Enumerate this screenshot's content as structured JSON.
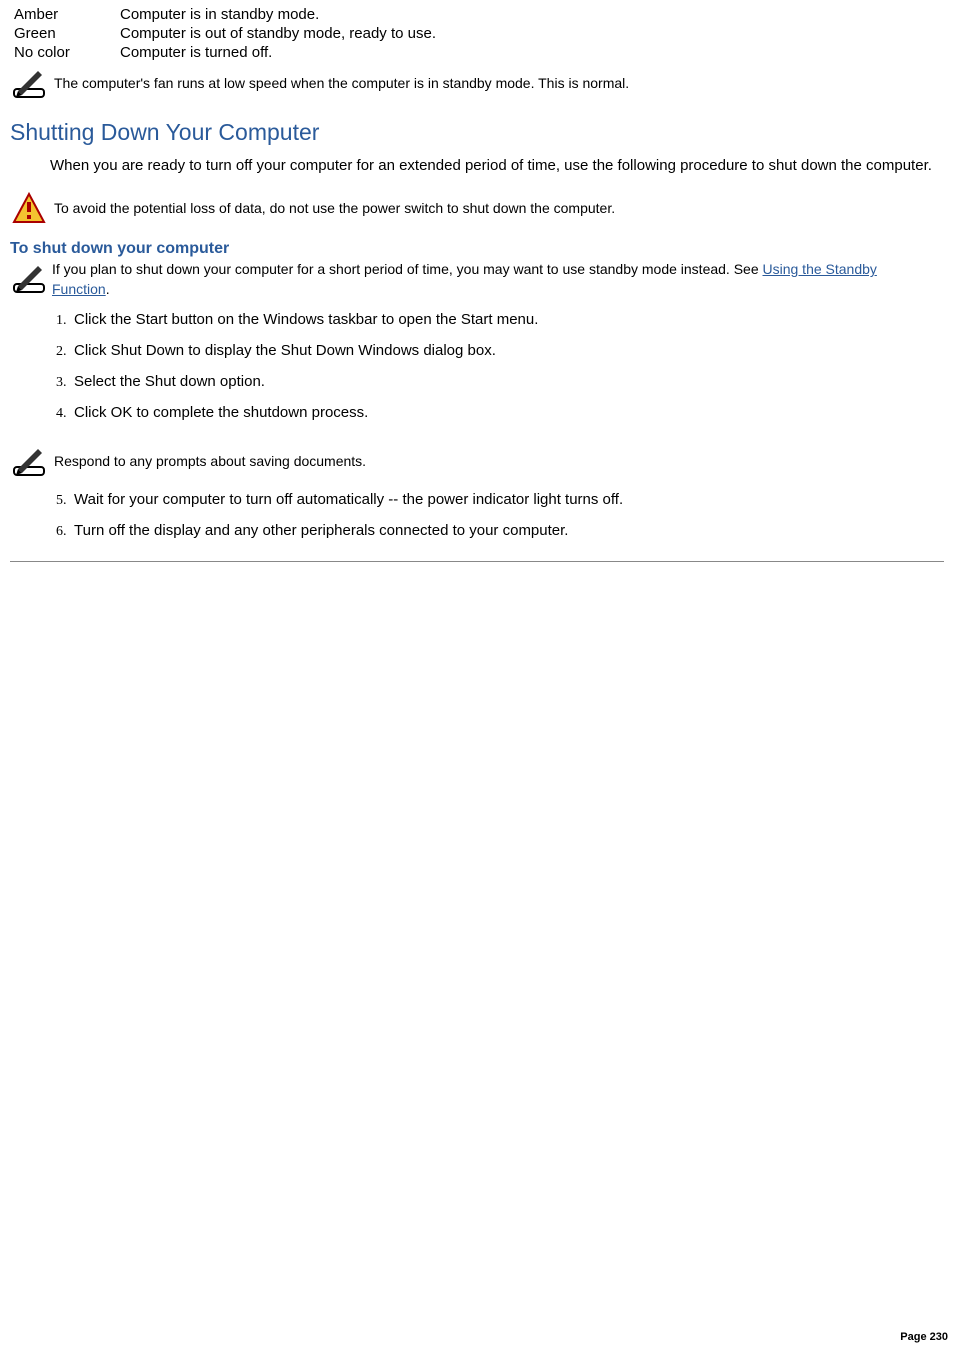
{
  "status_table": {
    "rows": [
      {
        "label": "Amber",
        "desc": "Computer is in standby mode."
      },
      {
        "label": "Green",
        "desc": "Computer is out of standby mode, ready to use."
      },
      {
        "label": "No color",
        "desc": "Computer is turned off."
      }
    ]
  },
  "note1": "The computer's fan runs at low speed when the computer is in standby mode. This is normal.",
  "heading": "Shutting Down Your Computer",
  "intro": "When you are ready to turn off your computer for an extended period of time, use the following procedure to shut down the computer.",
  "warning": "To avoid the potential loss of data, do not use the power switch to shut down the computer.",
  "subhead": "To shut down your computer",
  "standby_note": {
    "pre": "If you plan to shut down your computer for a short period of time, you may want to use standby mode instead. See ",
    "link": "Using the Standby Function",
    "post": "."
  },
  "steps_a": [
    "Click the Start button on the Windows  taskbar to open the Start menu.",
    "Click Shut Down to display the Shut Down Windows dialog box.",
    "Select the Shut down option.",
    "Click OK to complete the shutdown process."
  ],
  "mid_note": "Respond to any prompts about saving documents.",
  "steps_b": [
    "Wait for your computer to turn off automatically -- the power indicator light turns off.",
    "Turn off the display and any other peripherals connected to your computer."
  ],
  "page_number": "Page 230"
}
